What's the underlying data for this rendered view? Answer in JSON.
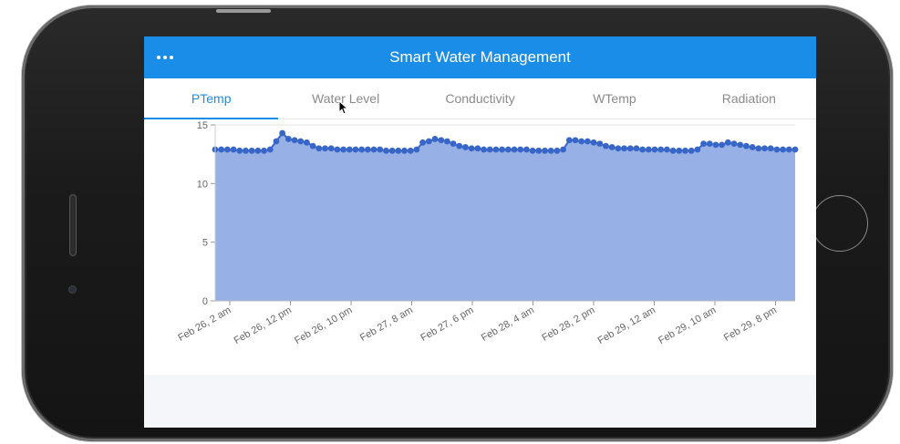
{
  "app": {
    "title": "Smart Water Management",
    "menu_icon": "more-dots-icon"
  },
  "tabs": [
    {
      "label": "PTemp",
      "active": true
    },
    {
      "label": "Water Level",
      "active": false
    },
    {
      "label": "Conductivity",
      "active": false
    },
    {
      "label": "WTemp",
      "active": false
    },
    {
      "label": "Radiation",
      "active": false
    }
  ],
  "colors": {
    "accent": "#1a8de9",
    "area_fill": "#97b1e6",
    "line": "#3866c8"
  },
  "chart_data": {
    "type": "area",
    "ylim": [
      0,
      15
    ],
    "yticks": [
      0,
      5,
      10,
      15
    ],
    "xticks": [
      "Feb 26, 2 am",
      "Feb 26, 12 pm",
      "Feb 26, 10 pm",
      "Feb 27, 8 am",
      "Feb 27, 6 pm",
      "Feb 28, 4 am",
      "Feb 28, 2 pm",
      "Feb 29, 12 am",
      "Feb 29, 10 am",
      "Feb 29, 8 pm"
    ],
    "values": [
      12.9,
      12.9,
      12.9,
      12.9,
      12.8,
      12.8,
      12.8,
      12.8,
      12.8,
      12.9,
      13.6,
      14.3,
      13.8,
      13.7,
      13.6,
      13.5,
      13.2,
      13.0,
      13.0,
      13.0,
      12.9,
      12.9,
      12.9,
      12.9,
      12.9,
      12.9,
      12.9,
      12.9,
      12.8,
      12.8,
      12.8,
      12.8,
      12.8,
      12.9,
      13.5,
      13.6,
      13.8,
      13.7,
      13.6,
      13.4,
      13.2,
      13.1,
      13.0,
      13.0,
      12.9,
      12.9,
      12.9,
      12.9,
      12.9,
      12.9,
      12.9,
      12.9,
      12.8,
      12.8,
      12.8,
      12.8,
      12.8,
      12.9,
      13.7,
      13.7,
      13.6,
      13.6,
      13.5,
      13.4,
      13.2,
      13.1,
      13.0,
      13.0,
      13.0,
      13.0,
      12.9,
      12.9,
      12.9,
      12.9,
      12.9,
      12.8,
      12.8,
      12.8,
      12.8,
      12.9,
      13.4,
      13.4,
      13.3,
      13.3,
      13.5,
      13.4,
      13.3,
      13.2,
      13.1,
      13.0,
      13.0,
      13.0,
      12.9,
      12.9,
      12.9,
      12.9
    ]
  }
}
